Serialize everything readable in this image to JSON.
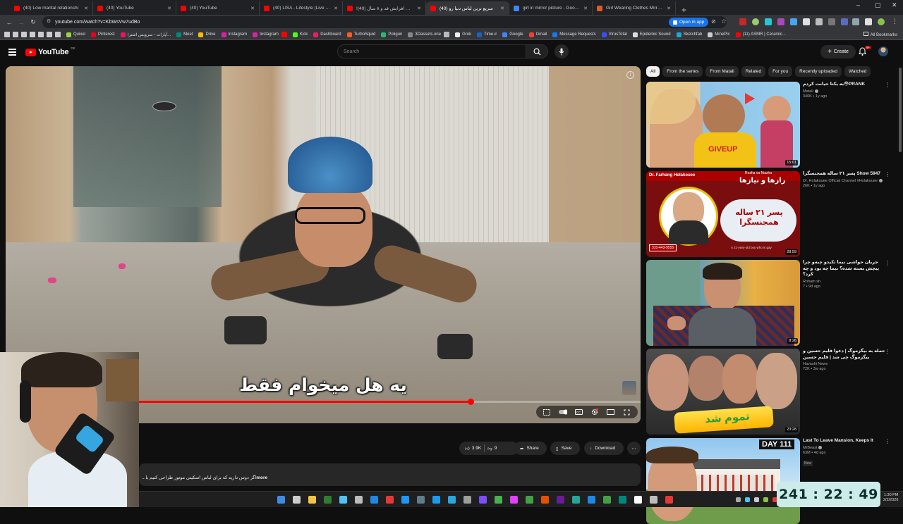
{
  "browser": {
    "tabs": [
      {
        "title": "(40) Low marital relationshi",
        "color": "#ff0000"
      },
      {
        "title": "(40) YouTube",
        "color": "#ff0000"
      },
      {
        "title": "(40) YouTube",
        "color": "#ff0000"
      },
      {
        "title": "(40) LISA - Lifestyle (Live at Co",
        "color": "#ff0000"
      },
      {
        "title": "!٨ ساعت افزایش قد و ۸ سال (40)",
        "color": "#ff0000"
      },
      {
        "title": "(40) سریع ترین لباس دنیا رو",
        "color": "#ff0000",
        "active": true
      },
      {
        "title": "girl in mirror picture - Google S",
        "color": "#4285f4"
      },
      {
        "title": "Girl Wearing Clothes Mirror Sel",
        "color": "#e05a2b"
      }
    ],
    "url": "youtube.com/watch?v=KbWsVw7udBo",
    "open_in_app": "Open in app",
    "bookmarks": [
      {
        "label": "",
        "color": "#ccc"
      },
      {
        "label": "",
        "color": "#ccc"
      },
      {
        "label": "",
        "color": "#ccc"
      },
      {
        "label": "",
        "color": "#ccc"
      },
      {
        "label": "",
        "color": "#ccc"
      },
      {
        "label": "",
        "color": "#ccc"
      },
      {
        "label": "",
        "color": "#ccc"
      },
      {
        "label": "Quixel",
        "color": "#9bd13f"
      },
      {
        "label": "Pinterest",
        "color": "#e60023"
      },
      {
        "label": "آپارات - سرویس اشترا...",
        "color": "#ed145b"
      },
      {
        "label": "Meet",
        "color": "#00897b"
      },
      {
        "label": "Drive",
        "color": "#fbbc04"
      },
      {
        "label": "Instagram",
        "color": "#d6249f"
      },
      {
        "label": "Instagram",
        "color": "#d6249f"
      },
      {
        "label": "",
        "color": "#ff0000"
      },
      {
        "label": "Kick",
        "color": "#53fc18"
      },
      {
        "label": "Dashboard",
        "color": "#e91e63"
      },
      {
        "label": "TurboSquid",
        "color": "#ff5a1f"
      },
      {
        "label": "Poligon",
        "color": "#2bb673"
      },
      {
        "label": "3Dassets.one",
        "color": "#888888"
      },
      {
        "label": "",
        "color": "#bbb"
      },
      {
        "label": "Grok",
        "color": "#eeeeee"
      },
      {
        "label": "Time.ir",
        "color": "#1565c0"
      },
      {
        "label": "Google",
        "color": "#4285f4"
      },
      {
        "label": "Gmail",
        "color": "#ea4335"
      },
      {
        "label": "Message Requests",
        "color": "#1877f2"
      },
      {
        "label": "VirusTotal",
        "color": "#394eff"
      },
      {
        "label": "Epidemic Sound",
        "color": "#dddddd"
      },
      {
        "label": "Sketchfab",
        "color": "#1caad9"
      },
      {
        "label": "MinePic",
        "color": "#cccccc"
      },
      {
        "label": "(11) ASMR | Ceramic...",
        "color": "#ff0000"
      }
    ],
    "all_bookmarks": "All Bookmarks"
  },
  "youtube": {
    "logo": "YouTube",
    "country": "DE",
    "search_placeholder": "Search",
    "create_label": "Create",
    "notif_count": "9+"
  },
  "player": {
    "subtitle": "یه هل میخوام فقط",
    "progress_fraction": 0.732
  },
  "actions": {
    "likes": "3.9K",
    "dislikes": "9",
    "share": "Share",
    "save": "Save",
    "download": "Download"
  },
  "description": {
    "text": "...اگر دوس دارید که برای لباس اسکیتی موتور طراحی کنیم با",
    "more": "more"
  },
  "chips": [
    "All",
    "From the series",
    "From Matali",
    "Related",
    "For you",
    "Recently uploaded",
    "Watched"
  ],
  "recommendations": [
    {
      "title": "به یکتا خیانت کردم😳PRANK",
      "channel": "Matali",
      "views": "340K",
      "age": "1y ago",
      "duration": "15:01",
      "verified": true,
      "badge": ""
    },
    {
      "title": "پسر ۲۱ ساله همجنسگرا Show 5947",
      "channel": "Dr. Holakouee Official Channel #Holakouee",
      "views": "26K",
      "age": "1y ago",
      "duration": "28:59",
      "verified": true,
      "badge": ""
    },
    {
      "title": "جریان حواشی نیما تکیدو چیه‌و چرا پیچش بسته شده؟ نیما چه بود و چه کرد؟",
      "channel": "Roham sh",
      "views": "7",
      "age": "9d ago",
      "duration": "8:26",
      "verified": false,
      "badge": ""
    },
    {
      "title": "حمله به بیگزموگ | دعوا فلیم حسین و بیگزموگ چی شد | فلیم حسین",
      "channel": "Havashi News",
      "views": "72K",
      "age": "3w ago",
      "duration": "23:28",
      "verified": false,
      "badge": ""
    },
    {
      "title": "Last To Leave Mansion, Keeps It",
      "channel": "MrBeast",
      "views": "63M",
      "age": "4d ago",
      "duration": "",
      "verified": true,
      "badge": "New"
    }
  ],
  "thumb_text": {
    "t1_banner": "GIVEUP",
    "t2_name": "Dr. Farhang Holakouee",
    "t2_title": "Rozha va Niazha",
    "t2_fa_title": "رازها و نیازها",
    "t2_headline": "پسر ۲۱ ساله همجنسگرا",
    "t2_sub": "A 21-year-old boy who is gay",
    "t2_call": "310-443-9555",
    "t4_text": "تموم شد",
    "t5_text": "DAY 111"
  },
  "timer": "241 : 22 : 49",
  "sysclock": {
    "time": "1:30 PM",
    "date": "2/2/2026"
  }
}
